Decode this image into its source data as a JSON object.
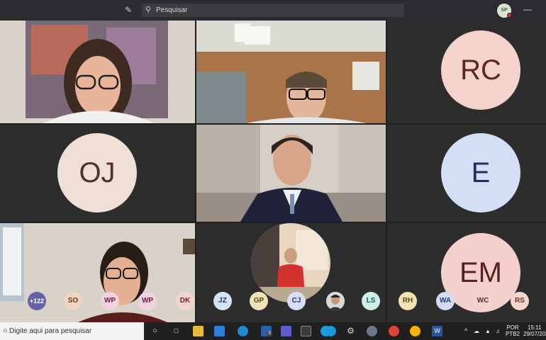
{
  "titlebar": {
    "search_placeholder": "Pesquisar",
    "me_initials": "SP",
    "minimize_glyph": "—",
    "compose_icon": "compose-icon"
  },
  "tiles": {
    "rc": {
      "initials": "RC",
      "bg": "#f4d3cc",
      "fg": "#5a2a1f"
    },
    "oj": {
      "initials": "OJ",
      "bg": "#f0dfd6",
      "fg": "#4e3326"
    },
    "e": {
      "initials": "E",
      "bg": "#d4def4",
      "fg": "#1f2f5c"
    },
    "em": {
      "initials": "EM",
      "bg": "#f4d0cd",
      "fg": "#5a1f1f"
    }
  },
  "overflow": {
    "count": "+122",
    "chips": [
      {
        "label": "SO",
        "bg": "#f1d5c4",
        "fg": "#6a3a1a"
      },
      {
        "label": "WP",
        "bg": "#f0d2e0",
        "fg": "#6a1f45"
      },
      {
        "label": "WP",
        "bg": "#f0d2e0",
        "fg": "#6a1f45"
      },
      {
        "label": "DK",
        "bg": "#f3d2cf",
        "fg": "#6a2a22"
      },
      {
        "label": "JZ",
        "bg": "#d4e2f4",
        "fg": "#1f3a6a"
      },
      {
        "label": "GP",
        "bg": "#f1e3b8",
        "fg": "#5a4612"
      },
      {
        "label": "CJ",
        "bg": "#d6def5",
        "fg": "#243a78"
      },
      {
        "label": "LS",
        "bg": "#cfeeea",
        "fg": "#1c5a52"
      },
      {
        "label": "RH",
        "bg": "#f3e3b4",
        "fg": "#5c4a14"
      },
      {
        "label": "WA",
        "bg": "#d3dcf3",
        "fg": "#233b78"
      },
      {
        "label": "WC",
        "bg": "#f2d3d2",
        "fg": "#6a2828"
      },
      {
        "label": "RS",
        "bg": "#f3d6cb",
        "fg": "#6a341e"
      }
    ]
  },
  "taskbar": {
    "search_text": "Digite aqui para pesquisar",
    "mail_badge": "3",
    "lang_top": "POR",
    "lang_bottom": "PTB2",
    "time": "15:11",
    "date": "29/07/202"
  }
}
